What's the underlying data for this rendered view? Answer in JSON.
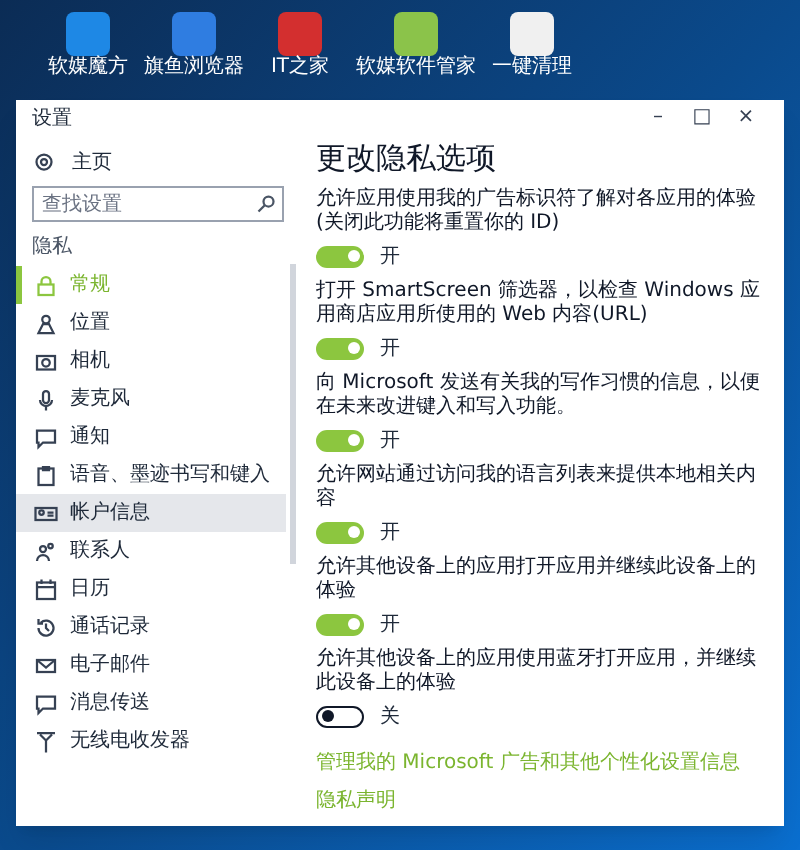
{
  "desktop_icons": [
    {
      "label": "软媒魔方",
      "color": "#1e88e5"
    },
    {
      "label": "旗鱼浏览器",
      "color": "#2f7de1"
    },
    {
      "label": "IT之家",
      "color": "#d32f2f"
    },
    {
      "label": "软媒软件管家",
      "color": "#8bc34a"
    },
    {
      "label": "一键清理",
      "color": "#f0f0f0"
    }
  ],
  "window": {
    "title": "设置",
    "controls": [
      "–",
      "□",
      "×"
    ]
  },
  "sidebar": {
    "home": "主页",
    "search": {
      "placeholder": "查找设置"
    },
    "section": "隐私",
    "items": [
      {
        "label": "常规",
        "selected": true,
        "highlighted": false
      },
      {
        "label": "位置",
        "selected": false,
        "highlighted": false
      },
      {
        "label": "相机",
        "selected": false,
        "highlighted": false
      },
      {
        "label": "麦克风",
        "selected": false,
        "highlighted": false
      },
      {
        "label": "通知",
        "selected": false,
        "highlighted": false
      },
      {
        "label": "语音、墨迹书写和键入",
        "selected": false,
        "highlighted": false
      },
      {
        "label": "帐户信息",
        "selected": false,
        "highlighted": true
      },
      {
        "label": "联系人",
        "selected": false,
        "highlighted": false
      },
      {
        "label": "日历",
        "selected": false,
        "highlighted": false
      },
      {
        "label": "通话记录",
        "selected": false,
        "highlighted": false
      },
      {
        "label": "电子邮件",
        "selected": false,
        "highlighted": false
      },
      {
        "label": "消息传送",
        "selected": false,
        "highlighted": false
      },
      {
        "label": "无线电收发器",
        "selected": false,
        "highlighted": false
      }
    ]
  },
  "content": {
    "title": "更改隐私选项",
    "options": [
      {
        "text": "允许应用使用我的广告标识符了解对各应用的体验(关闭此功能将重置你的 ID)",
        "on": true,
        "state_label": "开"
      },
      {
        "text": "打开 SmartScreen 筛选器，以检查 Windows 应用商店应用所使用的 Web 内容(URL)",
        "on": true,
        "state_label": "开"
      },
      {
        "text": "向 Microsoft 发送有关我的写作习惯的信息，以便在未来改进键入和写入功能。",
        "on": true,
        "state_label": "开"
      },
      {
        "text": "允许网站通过访问我的语言列表来提供本地相关内容",
        "on": true,
        "state_label": "开"
      },
      {
        "text": "允许其他设备上的应用打开应用并继续此设备上的体验",
        "on": true,
        "state_label": "开"
      },
      {
        "text": "允许其他设备上的应用使用蓝牙打开应用，并继续此设备上的体验",
        "on": false,
        "state_label": "关"
      }
    ],
    "links": [
      "管理我的 Microsoft 广告和其他个性化设置信息",
      "隐私声明"
    ]
  }
}
